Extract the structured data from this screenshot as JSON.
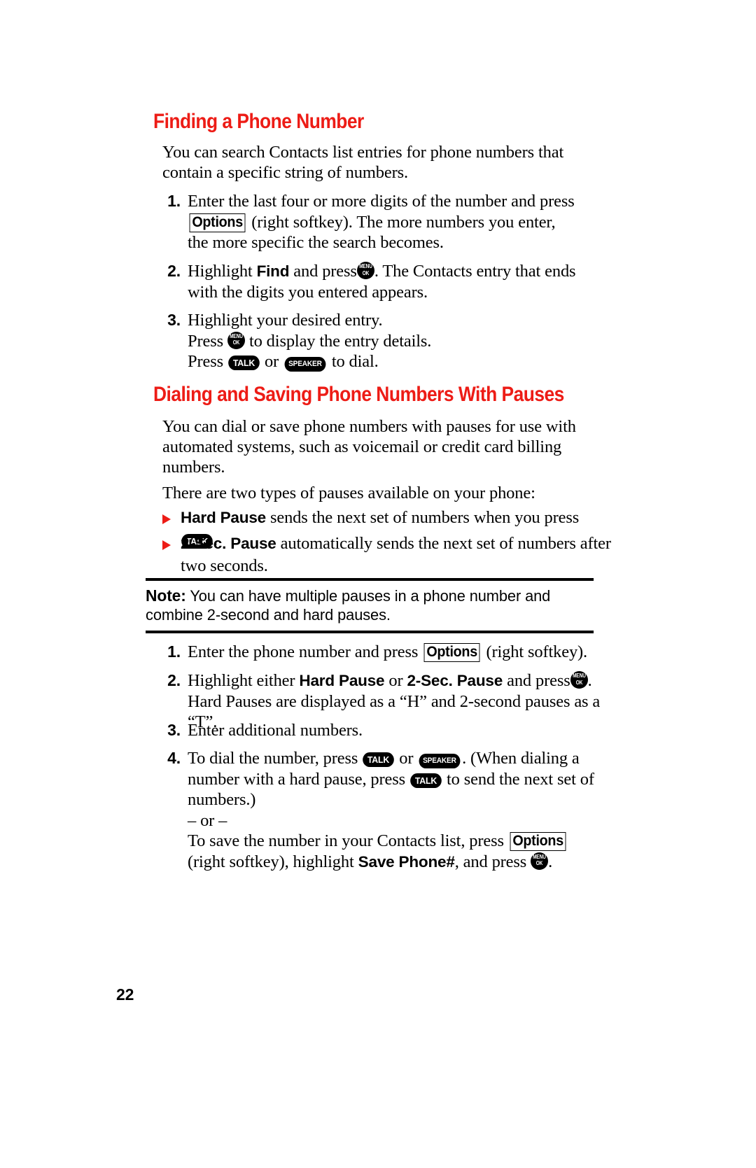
{
  "document": {
    "page_number": "22",
    "accent_color": "#ED1C16"
  },
  "sections": [
    {
      "heading": "Finding a Phone Number",
      "intro": "You can search Contacts list entries for phone numbers that contain a specific string of numbers.",
      "steps": [
        {
          "number": "1.",
          "part1": "Enter the last four or more digits of the number and press",
          "key": "Options",
          "part2": "(right softkey). The more numbers you enter, the more specific the search becomes."
        },
        {
          "number": "2.",
          "part1": "Highlight",
          "bold1": "Find",
          "part2": "and press",
          "part3": ". The Contacts entry that ends with the digits you entered appears."
        },
        {
          "number": "3.",
          "line1": "Highlight your desired entry.",
          "line2_pre": "Press",
          "line2_post": "to display the entry details.",
          "line3_pre": "Press",
          "line3_mid": "or",
          "line3_post": "to dial."
        }
      ]
    },
    {
      "heading": "Dialing and Saving Phone Numbers With Pauses",
      "intro": "You can dial or save phone numbers with pauses for use with automated systems, such as voicemail or credit card billing numbers.",
      "intro2": "There are two types of pauses available on your phone:",
      "bullets": [
        {
          "bold": "Hard Pause",
          "text_pre": "sends the next set of numbers when you press",
          "text_post": "."
        },
        {
          "bold": "2-Sec. Pause",
          "text_pre": "automatically sends the next set of numbers after two seconds.",
          "text_post": ""
        }
      ],
      "note": {
        "label": "Note:",
        "text": "You can have multiple pauses in a phone number and combine 2-second and hard pauses."
      },
      "steps": [
        {
          "number": "1.",
          "part1": "Enter the phone number and press",
          "key": "Options",
          "part2": "(right softkey)."
        },
        {
          "number": "2.",
          "part1": "Highlight either",
          "bold1": "Hard Pause",
          "part2": "or",
          "bold2": "2-Sec. Pause",
          "part3": "and press",
          "part4": ". Hard Pauses are displayed as a “H” and 2-second pauses as a “T”."
        },
        {
          "number": "3.",
          "part1": "Enter additional numbers."
        },
        {
          "number": "4.",
          "part1": "To dial the number, press",
          "part2": "or",
          "part3": ". (When dialing a number with a hard pause, press",
          "part4": "to send the next set of numbers.)",
          "or_divider": "– or –",
          "alt_pre": "To save the number in your Contacts list, press",
          "alt_key": "Options",
          "alt_mid": "(right softkey), highlight",
          "alt_bold": "Save Phone#",
          "alt_post": ", and press",
          "alt_end": "."
        }
      ]
    }
  ],
  "keys": {
    "talk": "TALK",
    "speaker": "SPEAKER",
    "menu": "MENU",
    "ok": "OK",
    "options": "Options"
  }
}
